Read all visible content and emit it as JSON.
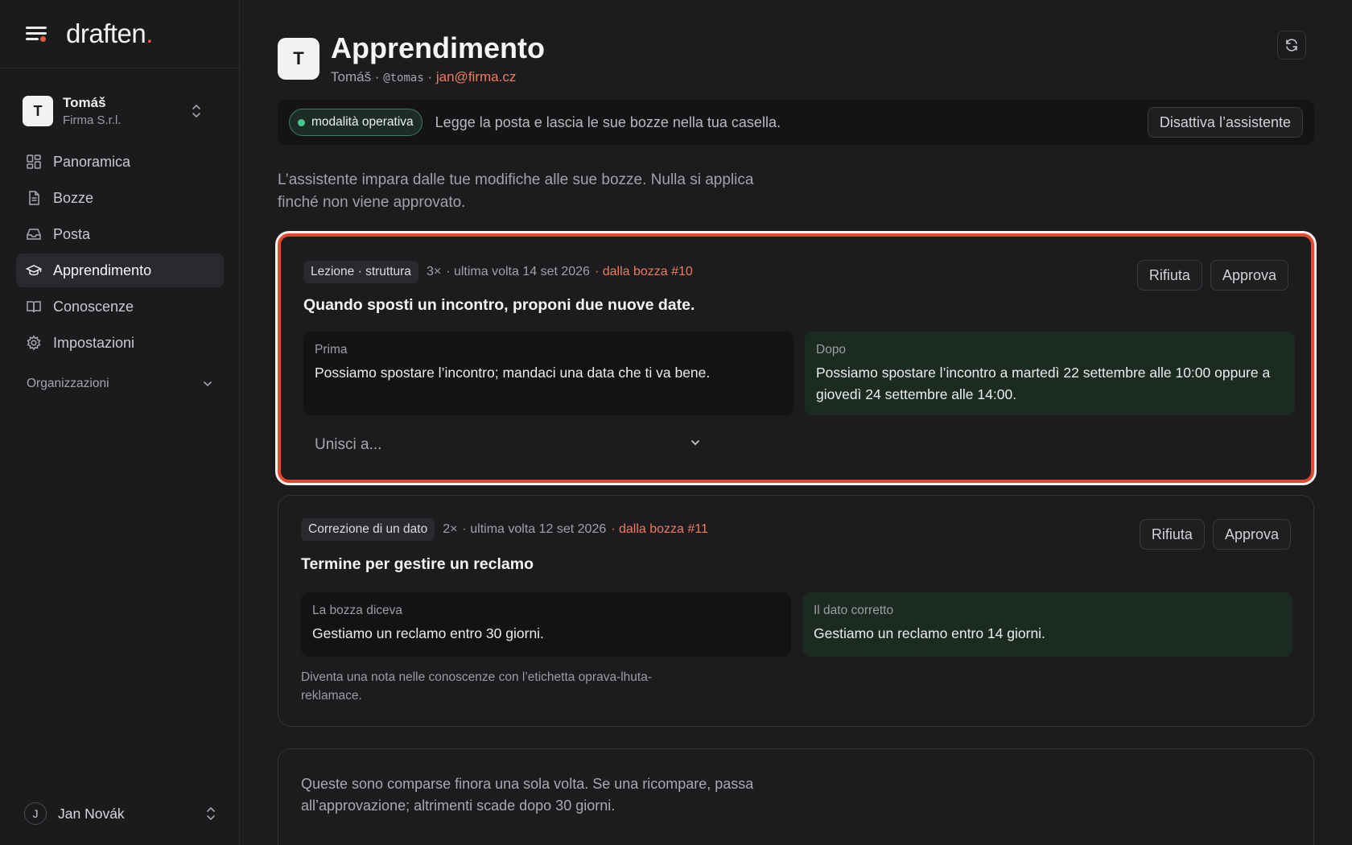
{
  "brand": {
    "name": "draften",
    "dot": "."
  },
  "account": {
    "initial": "T",
    "name": "Tomáš",
    "org": "Firma S.r.l."
  },
  "nav": [
    {
      "label": "Panoramica",
      "icon": "dashboard-icon"
    },
    {
      "label": "Bozze",
      "icon": "document-icon"
    },
    {
      "label": "Posta",
      "icon": "inbox-icon"
    },
    {
      "label": "Apprendimento",
      "icon": "graduation-cap-icon",
      "active": true
    },
    {
      "label": "Conoscenze",
      "icon": "book-icon"
    },
    {
      "label": "Impostazioni",
      "icon": "gear-icon"
    }
  ],
  "org_section": {
    "label": "Organizzazioni"
  },
  "user": {
    "initial": "J",
    "name": "Jan Novák"
  },
  "page": {
    "initial": "T",
    "title": "Apprendimento",
    "sub_name": "Tomáš",
    "sub_sep": " · ",
    "handle": "@tomas",
    "email": "jan@firma.cz"
  },
  "status": {
    "pill": "modalità operativa",
    "text": "Legge la posta e lascia le sue bozze nella tua casella.",
    "button": "Disattiva l’assistente"
  },
  "intro": "L’assistente impara dalle tue modifiche alle sue bozze. Nulla si applica finché non viene approvato.",
  "cards": [
    {
      "tag": "Lezione · struttura",
      "count": "3×",
      "last": "· ultima volta 14 set 2026",
      "source": "· dalla bozza #10",
      "reject": "Rifiuta",
      "approve": "Approva",
      "title": "Quando sposti un incontro, proponi due nuove date.",
      "before_label": "Prima",
      "before": "Possiamo spostare l’incontro; mandaci una data che ti va bene.",
      "after_label": "Dopo",
      "after": "Possiamo spostare l’incontro a martedì 22 settembre alle 10:00 oppure a giovedì 24 settembre alle 14:00.",
      "merge_placeholder": "Unisci a..."
    },
    {
      "tag": "Correzione di un dato",
      "count": "2×",
      "last": "· ultima volta 12 set 2026",
      "source": "· dalla bozza #11",
      "reject": "Rifiuta",
      "approve": "Approva",
      "title": "Termine per gestire un reclamo",
      "before_label": "La bozza diceva",
      "before": "Gestiamo un reclamo entro 30 giorni.",
      "after_label": "Il dato corretto",
      "after": "Gestiamo un reclamo entro 14 giorni.",
      "note": "Diventa una nota nelle conoscenze con l’etichetta oprava-lhuta-reklamace."
    }
  ],
  "pending": {
    "text": "Queste sono comparse finora una sola volta. Se una ricompare, passa all’approvazione; altrimenti scade dopo 30 giorni."
  },
  "colors": {
    "accent": "#ef7a5e",
    "highlight": "#e3492f",
    "success": "#45c98d"
  }
}
